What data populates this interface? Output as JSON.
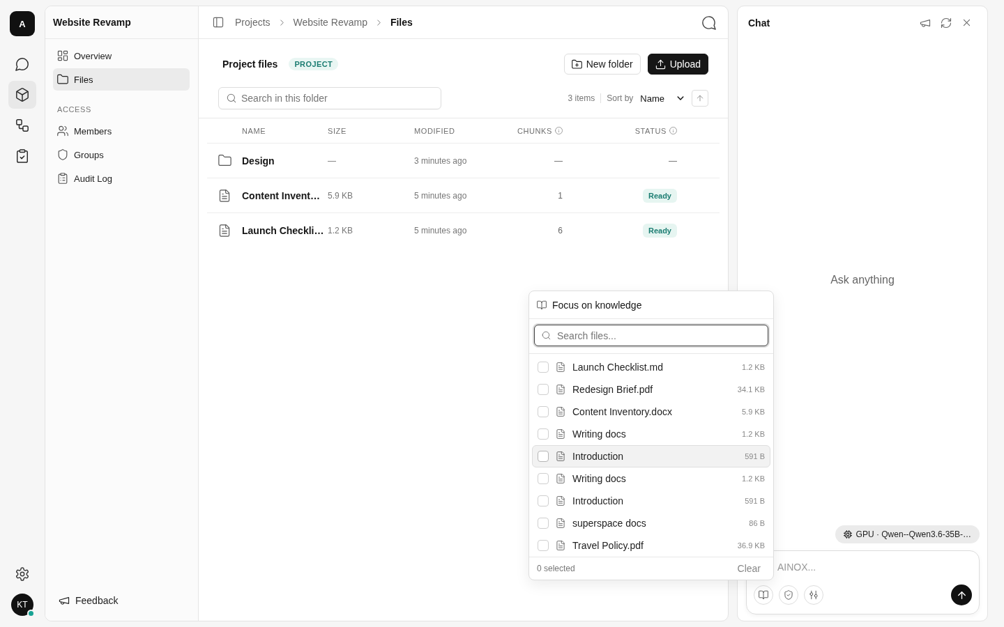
{
  "rail": {
    "logo": "A",
    "items": [
      {
        "selected": false
      },
      {
        "selected": true
      },
      {
        "selected": false
      },
      {
        "selected": false
      }
    ],
    "avatar": {
      "initials": "KT",
      "online": true
    }
  },
  "sidebar": {
    "title": "Website Revamp",
    "items": [
      {
        "label": "Overview",
        "selected": false
      },
      {
        "label": "Files",
        "selected": true
      }
    ],
    "section": {
      "heading": "ACCESS",
      "items": [
        {
          "label": "Members",
          "selected": false
        },
        {
          "label": "Groups",
          "selected": false
        },
        {
          "label": "Audit Log",
          "selected": false
        }
      ]
    },
    "feedback": "Feedback"
  },
  "header": {
    "breadcrumbs": [
      {
        "label": "Projects",
        "current": false
      },
      {
        "label": "Website Revamp",
        "current": false
      },
      {
        "label": "Files",
        "current": true
      }
    ]
  },
  "toolbar": {
    "title": "Project files",
    "badge": "PROJECT",
    "buttons": [
      {
        "label": "New folder",
        "kind": "secondary"
      },
      {
        "label": "Upload",
        "kind": "primary"
      }
    ],
    "search": {
      "placeholder": "Search in this folder"
    },
    "count": "3 items",
    "sort": {
      "label": "Sort by",
      "value": "Name"
    }
  },
  "table": {
    "columns": [
      {
        "label": "NAME",
        "info": false
      },
      {
        "label": "SIZE",
        "info": false
      },
      {
        "label": "MODIFIED",
        "info": false
      },
      {
        "label": "CHUNKS",
        "info": true
      },
      {
        "label": "STATUS",
        "info": true
      }
    ],
    "rows": [
      {
        "kind": "folder",
        "name": "Design",
        "size": "—",
        "modified": "3 minutes ago",
        "chunks": "—",
        "status": {
          "kind": "plain",
          "label": "—"
        }
      },
      {
        "kind": "file",
        "name": "Content Invent…",
        "size": "5.9 KB",
        "modified": "5 minutes ago",
        "chunks": "1",
        "status": {
          "kind": "badge",
          "label": "Ready"
        }
      },
      {
        "kind": "file",
        "name": "Launch Checkli…",
        "size": "1.2 KB",
        "modified": "5 minutes ago",
        "chunks": "6",
        "status": {
          "kind": "badge",
          "label": "Ready"
        }
      }
    ]
  },
  "knowledge_popup": {
    "title": "Focus on knowledge",
    "search": {
      "placeholder": "Search files...",
      "focused": true
    },
    "files": [
      {
        "name": "Launch Checklist.md",
        "size": "1.2 KB",
        "checked": false,
        "highlighted": false
      },
      {
        "name": "Redesign Brief.pdf",
        "size": "34.1 KB",
        "checked": false,
        "highlighted": false
      },
      {
        "name": "Content Inventory.docx",
        "size": "5.9 KB",
        "checked": false,
        "highlighted": false
      },
      {
        "name": "Writing docs",
        "size": "1.2 KB",
        "checked": false,
        "highlighted": false
      },
      {
        "name": "Introduction",
        "size": "591 B",
        "checked": false,
        "highlighted": true
      },
      {
        "name": "Writing docs",
        "size": "1.2 KB",
        "checked": false,
        "highlighted": false
      },
      {
        "name": "Introduction",
        "size": "591 B",
        "checked": false,
        "highlighted": false
      },
      {
        "name": "superspace docs",
        "size": "86 B",
        "checked": false,
        "highlighted": false
      },
      {
        "name": "Travel Policy.pdf",
        "size": "36.9 KB",
        "checked": false,
        "highlighted": false
      }
    ],
    "selected_count": "0 selected",
    "clear": "Clear"
  },
  "chat": {
    "title": "Chat",
    "empty_prompt": "Ask anything",
    "model": "GPU · Qwen--Qwen3.6-35B-…",
    "input": {
      "placeholder": "AINOX..."
    }
  }
}
